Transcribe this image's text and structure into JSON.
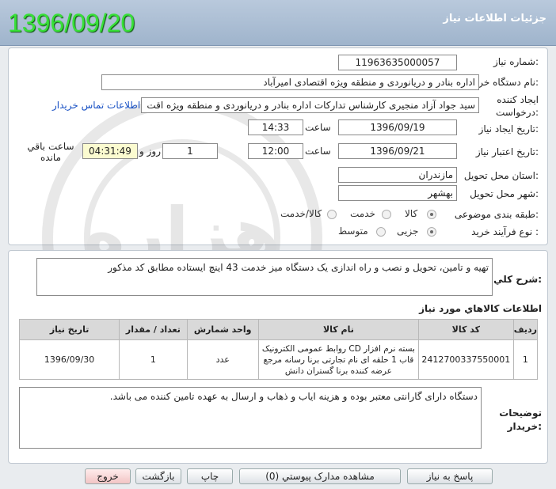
{
  "header": {
    "date": "1396/09/20",
    "title": "جزئيات اطلاعات نياز"
  },
  "form": {
    "need_number": {
      "label": "شماره نياز:",
      "value": "11963635000057"
    },
    "buyer_org": {
      "label": "نام دستگاه خريدار:",
      "value": "اداره بنادر و دریانوردی و منطقه ویژه اقتصادی امیرآباد"
    },
    "requester": {
      "label_1": "ايجاد كننده",
      "label_2": "درخواست:",
      "value": "سید جواد  آزاد منجیری کارشناس تدارکات اداره بنادر و دریانوردی و منطقه ویژه اقت",
      "contact_link": "اطلاعات تماس خريدار"
    },
    "created": {
      "label": "تاريخ ايجاد نياز:",
      "date": "1396/09/19",
      "time_label": "ساعت",
      "time": "14:33"
    },
    "validity": {
      "label": "تاريخ اعتبار نياز:",
      "date": "1396/09/21",
      "time_label": "ساعت",
      "time": "12:00",
      "days": "1",
      "days_label": "روز و",
      "remaining": "04:31:49",
      "remaining_label": "ساعت باقي مانده"
    },
    "province": {
      "label": "استان محل تحويل:",
      "value": "مازندران"
    },
    "city": {
      "label": "شهر محل تحويل:",
      "value": "بهشهر"
    },
    "category": {
      "label": "طبقه بندی موضوعی:",
      "options": [
        "كالا",
        "خدمت",
        "كالا/خدمت"
      ],
      "selected": "كالا"
    },
    "process": {
      "label": "نوع فرآيند خريد :",
      "options": [
        "جزیی",
        "متوسط"
      ],
      "selected": "جزیی"
    }
  },
  "description": {
    "label": "شرح كلي نياز:",
    "value": "تهیه و تامین، تحویل و نصب و راه اندازی یک دستگاه میز خدمت 43 اینچ ایستاده مطابق کد مذکور"
  },
  "items": {
    "title": "اطلاعات كالاهاي مورد نياز",
    "columns": [
      "رديف",
      "كد كالا",
      "نام كالا",
      "واحد شمارش",
      "تعداد / مقدار",
      "تاريخ نياز"
    ],
    "rows": [
      {
        "row": "1",
        "code": "2412700337550001",
        "name": "بسته نرم افزار CD روابط عمومی الکترونیک قاب 1 حلقه ای نام تجارتی برنا رسانه مرجع عرضه کننده برنا گستران دانش",
        "unit": "عدد",
        "qty": "1",
        "date": "1396/09/30"
      }
    ]
  },
  "buyer_notes": {
    "label_1": "توضيحات",
    "label_2": "خريدار:",
    "value": "دستگاه دارای گارانتی معتبر بوده و هزینه ایاب و ذهاب و ارسال به عهده تامین کننده می باشد."
  },
  "buttons": {
    "reply": "پاسخ به نياز",
    "attachments": "مشاهده مدارک پيوستي (0)",
    "print": "چاپ",
    "back": "بازگشت",
    "exit": "خروج"
  },
  "watermark": {
    "text": "هزاره",
    "subtext": "گستران ارتباط"
  }
}
